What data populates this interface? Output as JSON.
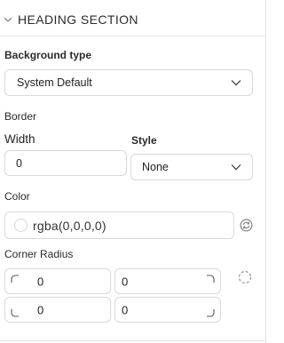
{
  "section": {
    "title": "HEADING SECTION"
  },
  "background": {
    "label": "Background type",
    "value": "System Default"
  },
  "border": {
    "label": "Border",
    "width_label": "Width",
    "width_value": "0",
    "style_label": "Style",
    "style_value": "None"
  },
  "color": {
    "label": "Color",
    "value": "rgba(0,0,0,0)"
  },
  "corner_radius": {
    "label": "Corner Radius",
    "top_left": "0",
    "top_right": "0",
    "bottom_left": "0",
    "bottom_right": "0"
  },
  "icons": {
    "section_toggle": "chevron-down-icon",
    "select_caret": "chevron-down-icon",
    "color_reset": "refresh-icon",
    "radius_link": "dashed-circle-icon"
  },
  "colors": {
    "border": "#d9d9d9",
    "text": "#222222",
    "icon": "#7a7a7a"
  }
}
